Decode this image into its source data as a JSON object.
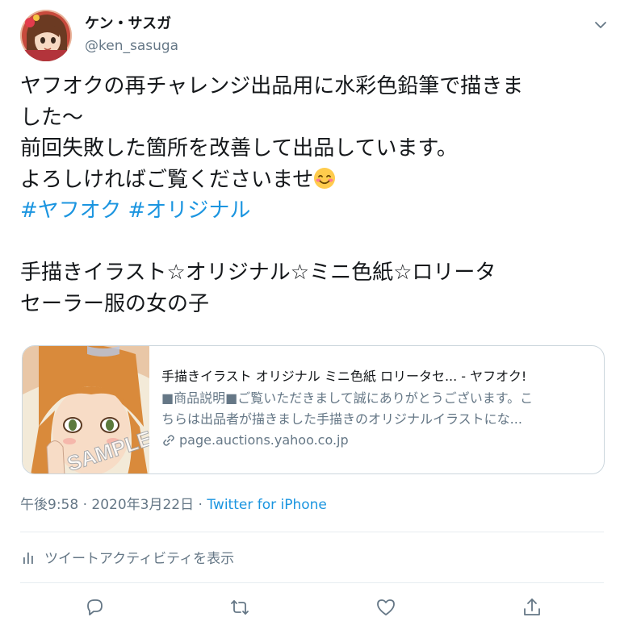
{
  "user": {
    "display_name": "ケン・サスガ",
    "handle": "@ken_sasuga"
  },
  "tweet": {
    "line1": "ヤフオクの再チャレンジ出品用に水彩色鉛筆で描きま",
    "line2": "した～",
    "line3": "前回失敗した箇所を改善して出品しています。",
    "line4": "よろしければご覧くださいませ",
    "emoji": "smiling-face-with-blush-emoji",
    "hashtags": [
      "#ヤフオク",
      "#オリジナル"
    ],
    "line6": "手描きイラスト☆オリジナル☆ミニ色紙☆ロリータ",
    "line7": "セーラー服の女の子"
  },
  "card": {
    "title": "手描きイラスト オリジナル ミニ色紙 ロリータセ... - ヤフオク!",
    "desc_line1": "■商品説明■ご覧いただきまして誠にありがとうございます。こ",
    "desc_line2": "ちらは出品者が描きました手描きのオリジナルイラストにな...",
    "url": "page.auctions.yahoo.co.jp",
    "thumb_watermark": "SAMPLE"
  },
  "meta": {
    "time": "午後9:58",
    "sep1": " · ",
    "date": "2020年3月22日",
    "sep2": " · ",
    "source": "Twitter for iPhone"
  },
  "activity": {
    "label": "ツイートアクティビティを表示"
  },
  "colors": {
    "link": "#1b95e0",
    "secondary": "#657786",
    "border": "#ccd6dd"
  }
}
